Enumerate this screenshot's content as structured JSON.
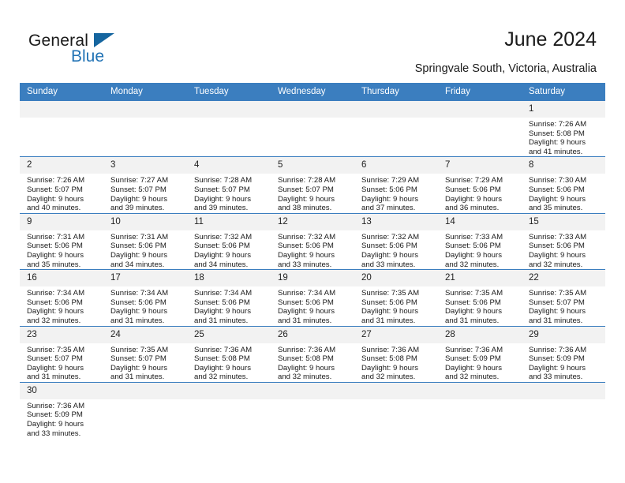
{
  "logo": {
    "word_one": "General",
    "word_two": "Blue",
    "triangle_color": "#15659f",
    "blue_color": "#2273b5"
  },
  "header": {
    "title": "June 2024",
    "subtitle": "Springvale South, Victoria, Australia"
  },
  "theme": {
    "header_blue": "#3b7ebf",
    "daynum_gray": "#f2f2f2",
    "text": "#1a1a1a"
  },
  "calendar": {
    "weekday_headers": [
      "Sunday",
      "Monday",
      "Tuesday",
      "Wednesday",
      "Thursday",
      "Friday",
      "Saturday"
    ],
    "weeks": [
      [
        {
          "day": "",
          "sunrise": "",
          "sunset": "",
          "daylight_line1": "",
          "daylight_line2": ""
        },
        {
          "day": "",
          "sunrise": "",
          "sunset": "",
          "daylight_line1": "",
          "daylight_line2": ""
        },
        {
          "day": "",
          "sunrise": "",
          "sunset": "",
          "daylight_line1": "",
          "daylight_line2": ""
        },
        {
          "day": "",
          "sunrise": "",
          "sunset": "",
          "daylight_line1": "",
          "daylight_line2": ""
        },
        {
          "day": "",
          "sunrise": "",
          "sunset": "",
          "daylight_line1": "",
          "daylight_line2": ""
        },
        {
          "day": "",
          "sunrise": "",
          "sunset": "",
          "daylight_line1": "",
          "daylight_line2": ""
        },
        {
          "day": "1",
          "sunrise": "Sunrise: 7:26 AM",
          "sunset": "Sunset: 5:08 PM",
          "daylight_line1": "Daylight: 9 hours",
          "daylight_line2": "and 41 minutes."
        }
      ],
      [
        {
          "day": "2",
          "sunrise": "Sunrise: 7:26 AM",
          "sunset": "Sunset: 5:07 PM",
          "daylight_line1": "Daylight: 9 hours",
          "daylight_line2": "and 40 minutes."
        },
        {
          "day": "3",
          "sunrise": "Sunrise: 7:27 AM",
          "sunset": "Sunset: 5:07 PM",
          "daylight_line1": "Daylight: 9 hours",
          "daylight_line2": "and 39 minutes."
        },
        {
          "day": "4",
          "sunrise": "Sunrise: 7:28 AM",
          "sunset": "Sunset: 5:07 PM",
          "daylight_line1": "Daylight: 9 hours",
          "daylight_line2": "and 39 minutes."
        },
        {
          "day": "5",
          "sunrise": "Sunrise: 7:28 AM",
          "sunset": "Sunset: 5:07 PM",
          "daylight_line1": "Daylight: 9 hours",
          "daylight_line2": "and 38 minutes."
        },
        {
          "day": "6",
          "sunrise": "Sunrise: 7:29 AM",
          "sunset": "Sunset: 5:06 PM",
          "daylight_line1": "Daylight: 9 hours",
          "daylight_line2": "and 37 minutes."
        },
        {
          "day": "7",
          "sunrise": "Sunrise: 7:29 AM",
          "sunset": "Sunset: 5:06 PM",
          "daylight_line1": "Daylight: 9 hours",
          "daylight_line2": "and 36 minutes."
        },
        {
          "day": "8",
          "sunrise": "Sunrise: 7:30 AM",
          "sunset": "Sunset: 5:06 PM",
          "daylight_line1": "Daylight: 9 hours",
          "daylight_line2": "and 35 minutes."
        }
      ],
      [
        {
          "day": "9",
          "sunrise": "Sunrise: 7:31 AM",
          "sunset": "Sunset: 5:06 PM",
          "daylight_line1": "Daylight: 9 hours",
          "daylight_line2": "and 35 minutes."
        },
        {
          "day": "10",
          "sunrise": "Sunrise: 7:31 AM",
          "sunset": "Sunset: 5:06 PM",
          "daylight_line1": "Daylight: 9 hours",
          "daylight_line2": "and 34 minutes."
        },
        {
          "day": "11",
          "sunrise": "Sunrise: 7:32 AM",
          "sunset": "Sunset: 5:06 PM",
          "daylight_line1": "Daylight: 9 hours",
          "daylight_line2": "and 34 minutes."
        },
        {
          "day": "12",
          "sunrise": "Sunrise: 7:32 AM",
          "sunset": "Sunset: 5:06 PM",
          "daylight_line1": "Daylight: 9 hours",
          "daylight_line2": "and 33 minutes."
        },
        {
          "day": "13",
          "sunrise": "Sunrise: 7:32 AM",
          "sunset": "Sunset: 5:06 PM",
          "daylight_line1": "Daylight: 9 hours",
          "daylight_line2": "and 33 minutes."
        },
        {
          "day": "14",
          "sunrise": "Sunrise: 7:33 AM",
          "sunset": "Sunset: 5:06 PM",
          "daylight_line1": "Daylight: 9 hours",
          "daylight_line2": "and 32 minutes."
        },
        {
          "day": "15",
          "sunrise": "Sunrise: 7:33 AM",
          "sunset": "Sunset: 5:06 PM",
          "daylight_line1": "Daylight: 9 hours",
          "daylight_line2": "and 32 minutes."
        }
      ],
      [
        {
          "day": "16",
          "sunrise": "Sunrise: 7:34 AM",
          "sunset": "Sunset: 5:06 PM",
          "daylight_line1": "Daylight: 9 hours",
          "daylight_line2": "and 32 minutes."
        },
        {
          "day": "17",
          "sunrise": "Sunrise: 7:34 AM",
          "sunset": "Sunset: 5:06 PM",
          "daylight_line1": "Daylight: 9 hours",
          "daylight_line2": "and 31 minutes."
        },
        {
          "day": "18",
          "sunrise": "Sunrise: 7:34 AM",
          "sunset": "Sunset: 5:06 PM",
          "daylight_line1": "Daylight: 9 hours",
          "daylight_line2": "and 31 minutes."
        },
        {
          "day": "19",
          "sunrise": "Sunrise: 7:34 AM",
          "sunset": "Sunset: 5:06 PM",
          "daylight_line1": "Daylight: 9 hours",
          "daylight_line2": "and 31 minutes."
        },
        {
          "day": "20",
          "sunrise": "Sunrise: 7:35 AM",
          "sunset": "Sunset: 5:06 PM",
          "daylight_line1": "Daylight: 9 hours",
          "daylight_line2": "and 31 minutes."
        },
        {
          "day": "21",
          "sunrise": "Sunrise: 7:35 AM",
          "sunset": "Sunset: 5:06 PM",
          "daylight_line1": "Daylight: 9 hours",
          "daylight_line2": "and 31 minutes."
        },
        {
          "day": "22",
          "sunrise": "Sunrise: 7:35 AM",
          "sunset": "Sunset: 5:07 PM",
          "daylight_line1": "Daylight: 9 hours",
          "daylight_line2": "and 31 minutes."
        }
      ],
      [
        {
          "day": "23",
          "sunrise": "Sunrise: 7:35 AM",
          "sunset": "Sunset: 5:07 PM",
          "daylight_line1": "Daylight: 9 hours",
          "daylight_line2": "and 31 minutes."
        },
        {
          "day": "24",
          "sunrise": "Sunrise: 7:35 AM",
          "sunset": "Sunset: 5:07 PM",
          "daylight_line1": "Daylight: 9 hours",
          "daylight_line2": "and 31 minutes."
        },
        {
          "day": "25",
          "sunrise": "Sunrise: 7:36 AM",
          "sunset": "Sunset: 5:08 PM",
          "daylight_line1": "Daylight: 9 hours",
          "daylight_line2": "and 32 minutes."
        },
        {
          "day": "26",
          "sunrise": "Sunrise: 7:36 AM",
          "sunset": "Sunset: 5:08 PM",
          "daylight_line1": "Daylight: 9 hours",
          "daylight_line2": "and 32 minutes."
        },
        {
          "day": "27",
          "sunrise": "Sunrise: 7:36 AM",
          "sunset": "Sunset: 5:08 PM",
          "daylight_line1": "Daylight: 9 hours",
          "daylight_line2": "and 32 minutes."
        },
        {
          "day": "28",
          "sunrise": "Sunrise: 7:36 AM",
          "sunset": "Sunset: 5:09 PM",
          "daylight_line1": "Daylight: 9 hours",
          "daylight_line2": "and 32 minutes."
        },
        {
          "day": "29",
          "sunrise": "Sunrise: 7:36 AM",
          "sunset": "Sunset: 5:09 PM",
          "daylight_line1": "Daylight: 9 hours",
          "daylight_line2": "and 33 minutes."
        }
      ],
      [
        {
          "day": "30",
          "sunrise": "Sunrise: 7:36 AM",
          "sunset": "Sunset: 5:09 PM",
          "daylight_line1": "Daylight: 9 hours",
          "daylight_line2": "and 33 minutes."
        },
        {
          "day": "",
          "sunrise": "",
          "sunset": "",
          "daylight_line1": "",
          "daylight_line2": ""
        },
        {
          "day": "",
          "sunrise": "",
          "sunset": "",
          "daylight_line1": "",
          "daylight_line2": ""
        },
        {
          "day": "",
          "sunrise": "",
          "sunset": "",
          "daylight_line1": "",
          "daylight_line2": ""
        },
        {
          "day": "",
          "sunrise": "",
          "sunset": "",
          "daylight_line1": "",
          "daylight_line2": ""
        },
        {
          "day": "",
          "sunrise": "",
          "sunset": "",
          "daylight_line1": "",
          "daylight_line2": ""
        },
        {
          "day": "",
          "sunrise": "",
          "sunset": "",
          "daylight_line1": "",
          "daylight_line2": ""
        }
      ]
    ]
  }
}
